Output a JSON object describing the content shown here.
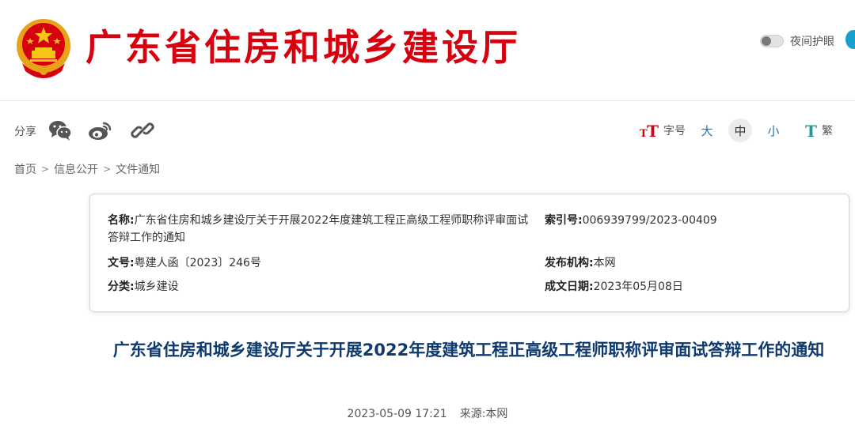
{
  "header": {
    "site_title": "广东省住房和城乡建设厅",
    "emblem_icon": "national-emblem-icon",
    "night_mode_label": "夜间护眼"
  },
  "toolbar": {
    "share_label": "分享",
    "share_icons": [
      "wechat-icon",
      "weibo-icon",
      "link-icon"
    ],
    "font_size_label": "字号",
    "font_sizes": [
      {
        "label": "大",
        "active": false
      },
      {
        "label": "中",
        "active": true
      },
      {
        "label": "小",
        "active": false
      }
    ],
    "traditional_label": "繁"
  },
  "breadcrumb": [
    "首页",
    "信息公开",
    "文件通知"
  ],
  "info": {
    "name_key": "名称:",
    "name_value": "广东省住房和城乡建设厅关于开展2022年度建筑工程正高级工程师职称评审面试答辩工作的通知",
    "index_key": "索引号:",
    "index_value": "006939799/2023-00409",
    "docno_key": "文号:",
    "docno_value": "粤建人函〔2023〕246号",
    "org_key": "发布机构:",
    "org_value": "本网",
    "category_key": "分类:",
    "category_value": "城乡建设",
    "date_key": "成文日期:",
    "date_value": "2023年05月08日"
  },
  "article": {
    "title": "广东省住房和城乡建设厅关于开展2022年度建筑工程正高级工程师职称评审面试答辩工作的通知",
    "date": "2023-05-09  17:21",
    "source": "来源:本网"
  },
  "colors": {
    "brand_red": "#d7000f",
    "title_blue": "#0f3a6e",
    "link_blue": "#2a6fb7"
  }
}
